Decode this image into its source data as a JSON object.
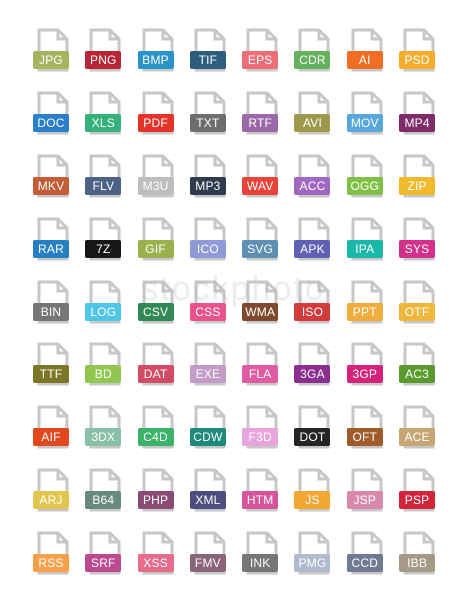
{
  "watermark": "stockphoto",
  "icon_colors": {
    "outline": "#c7c7c7"
  },
  "files": [
    {
      "label": "JPG",
      "color": "#a4b55d"
    },
    {
      "label": "PNG",
      "color": "#b72634"
    },
    {
      "label": "BMP",
      "color": "#2a94c9"
    },
    {
      "label": "TIF",
      "color": "#2d5e7e"
    },
    {
      "label": "EPS",
      "color": "#ee6e77"
    },
    {
      "label": "CDR",
      "color": "#65b25d"
    },
    {
      "label": "AI",
      "color": "#f16e24"
    },
    {
      "label": "PSD",
      "color": "#f6ad2e"
    },
    {
      "label": "DOC",
      "color": "#2a7fc8"
    },
    {
      "label": "XLS",
      "color": "#35b27a"
    },
    {
      "label": "PDF",
      "color": "#e4332a"
    },
    {
      "label": "TXT",
      "color": "#6e6e6e"
    },
    {
      "label": "RTF",
      "color": "#9d68a8"
    },
    {
      "label": "AVI",
      "color": "#9c9a4a"
    },
    {
      "label": "MOV",
      "color": "#57a7dc"
    },
    {
      "label": "MP4",
      "color": "#7e2c6a"
    },
    {
      "label": "MKV",
      "color": "#c45c36"
    },
    {
      "label": "FLV",
      "color": "#4d6285"
    },
    {
      "label": "M3U",
      "color": "#bdbdbd"
    },
    {
      "label": "MP3",
      "color": "#2f3c4e"
    },
    {
      "label": "WAV",
      "color": "#e8443a"
    },
    {
      "label": "ACC",
      "color": "#a168c2"
    },
    {
      "label": "OGG",
      "color": "#80c146"
    },
    {
      "label": "ZIP",
      "color": "#efba2b"
    },
    {
      "label": "RAR",
      "color": "#267fc1"
    },
    {
      "label": "7Z",
      "color": "#161616"
    },
    {
      "label": "GIF",
      "color": "#9bb04d"
    },
    {
      "label": "ICO",
      "color": "#8f9ad6"
    },
    {
      "label": "SVG",
      "color": "#5f8fb3"
    },
    {
      "label": "APK",
      "color": "#6060b4"
    },
    {
      "label": "IPA",
      "color": "#1ab8a8"
    },
    {
      "label": "SYS",
      "color": "#d2308a"
    },
    {
      "label": "BIN",
      "color": "#767676"
    },
    {
      "label": "LOG",
      "color": "#4fc6e6"
    },
    {
      "label": "CSV",
      "color": "#318a55"
    },
    {
      "label": "CSS",
      "color": "#e8528d"
    },
    {
      "label": "WMA",
      "color": "#7f4a2c"
    },
    {
      "label": "ISO",
      "color": "#d23b3b"
    },
    {
      "label": "PPT",
      "color": "#f0ac3d"
    },
    {
      "label": "OTF",
      "color": "#efb73b"
    },
    {
      "label": "TTF",
      "color": "#7e7627"
    },
    {
      "label": "BD",
      "color": "#92c74f"
    },
    {
      "label": "DAT",
      "color": "#d24a63"
    },
    {
      "label": "EXE",
      "color": "#c49ac6"
    },
    {
      "label": "FLA",
      "color": "#df5ca3"
    },
    {
      "label": "3GA",
      "color": "#8a2f8f"
    },
    {
      "label": "3GP",
      "color": "#d4217a"
    },
    {
      "label": "AC3",
      "color": "#5a9b2d"
    },
    {
      "label": "AIF",
      "color": "#e2481d"
    },
    {
      "label": "3DX",
      "color": "#8ac0a9"
    },
    {
      "label": "C4D",
      "color": "#3ab369"
    },
    {
      "label": "CDW",
      "color": "#1d8a7b"
    },
    {
      "label": "F3D",
      "color": "#e8a4dd"
    },
    {
      "label": "DOT",
      "color": "#252525"
    },
    {
      "label": "OFT",
      "color": "#a05a2b"
    },
    {
      "label": "ACE",
      "color": "#c8a674"
    },
    {
      "label": "ARJ",
      "color": "#e2c54d"
    },
    {
      "label": "B64",
      "color": "#67897f"
    },
    {
      "label": "PHP",
      "color": "#8b4a74"
    },
    {
      "label": "XML",
      "color": "#4f4d7e"
    },
    {
      "label": "HTM",
      "color": "#d7539a"
    },
    {
      "label": "JS",
      "color": "#f2a634"
    },
    {
      "label": "JSP",
      "color": "#d98aab"
    },
    {
      "label": "PSP",
      "color": "#d2243b"
    },
    {
      "label": "RSS",
      "color": "#f6a04a"
    },
    {
      "label": "SRF",
      "color": "#bc4a8f"
    },
    {
      "label": "XSS",
      "color": "#e86b8b"
    },
    {
      "label": "FMV",
      "color": "#8a6478"
    },
    {
      "label": "INK",
      "color": "#767676"
    },
    {
      "label": "PMG",
      "color": "#b0b9cf"
    },
    {
      "label": "CCD",
      "color": "#707a93"
    },
    {
      "label": "IBB",
      "color": "#a49a87"
    }
  ]
}
